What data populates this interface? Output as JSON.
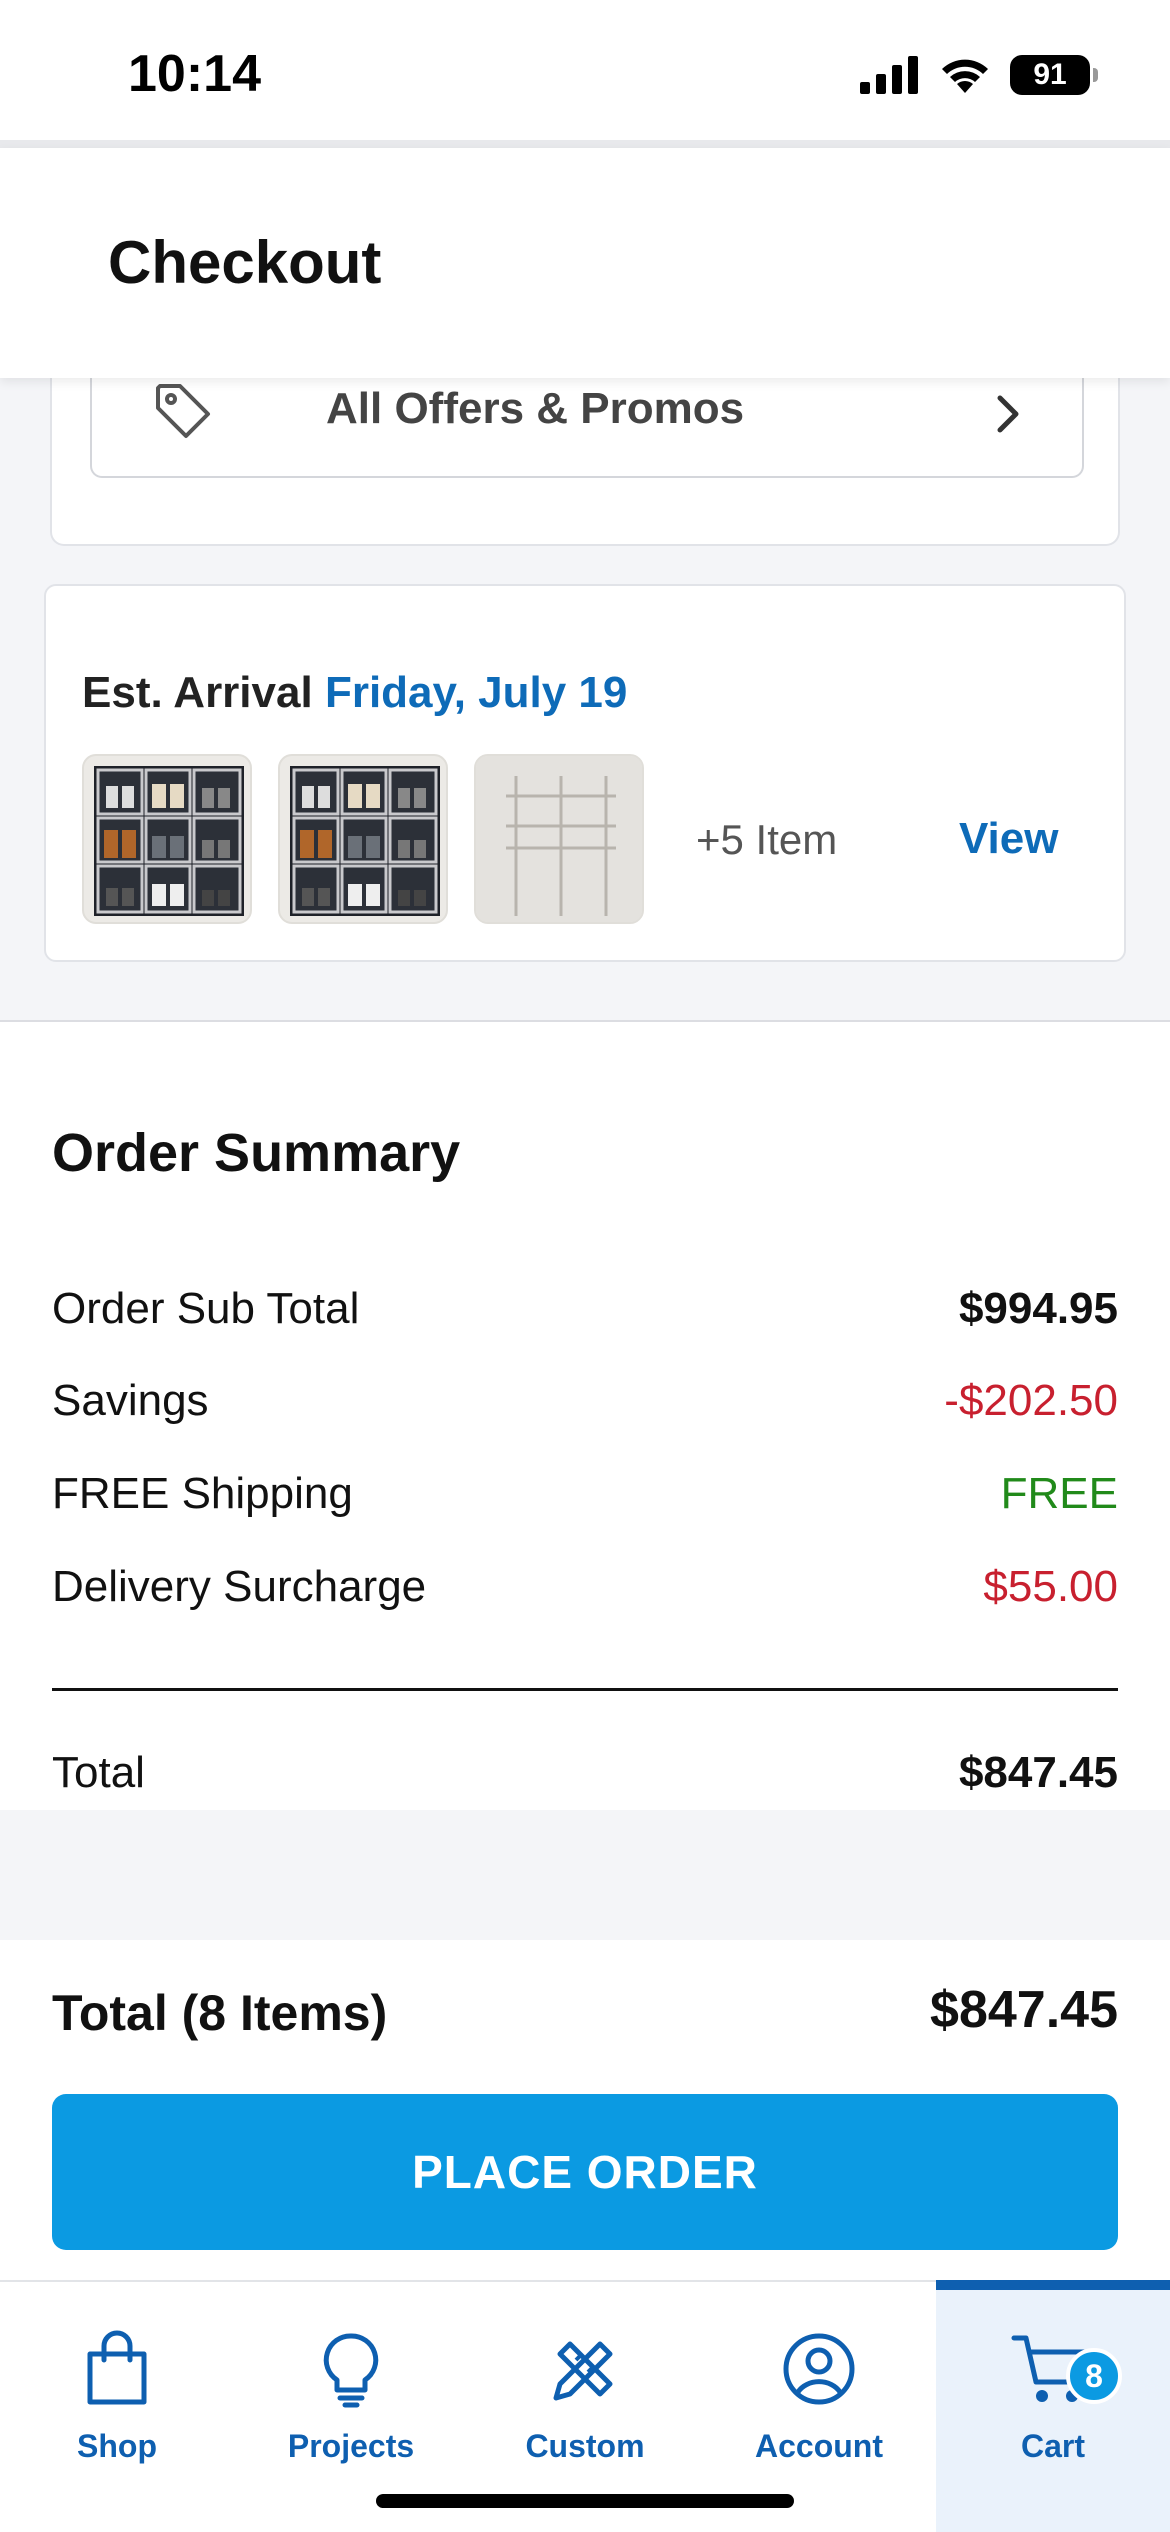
{
  "status_bar": {
    "time": "10:14",
    "battery": "91"
  },
  "header": {
    "title": "Checkout"
  },
  "offers": {
    "label": "All Offers & Promos"
  },
  "arrival": {
    "label": "Est. Arrival",
    "date": "Friday, July 19",
    "more_items": "+5 Item",
    "view_label": "View"
  },
  "summary": {
    "title": "Order Summary",
    "rows": [
      {
        "label": "Order Sub Total",
        "value": "$994.95"
      },
      {
        "label": "Savings",
        "value": "-$202.50"
      },
      {
        "label": "FREE Shipping",
        "value": "FREE"
      },
      {
        "label": "Delivery Surcharge",
        "value": "$55.00"
      }
    ],
    "total_label": "Total",
    "total_value": "$847.45"
  },
  "checkout_bar": {
    "total_label": "Total (8 Items)",
    "total_value": "$847.45",
    "button_label": "PLACE ORDER"
  },
  "tabbar": {
    "tabs": [
      {
        "label": "Shop",
        "icon": "shopping-bag-icon"
      },
      {
        "label": "Projects",
        "icon": "lightbulb-icon"
      },
      {
        "label": "Custom",
        "icon": "pencil-ruler-icon"
      },
      {
        "label": "Account",
        "icon": "user-circle-icon"
      },
      {
        "label": "Cart",
        "icon": "cart-icon",
        "badge": "8",
        "active": true
      }
    ]
  },
  "colors": {
    "accent_blue": "#0b9ae2",
    "link_blue": "#0e6bb8",
    "savings_red": "#c8202f",
    "free_green": "#218a1a",
    "tab_blue": "#0e5fb0"
  }
}
